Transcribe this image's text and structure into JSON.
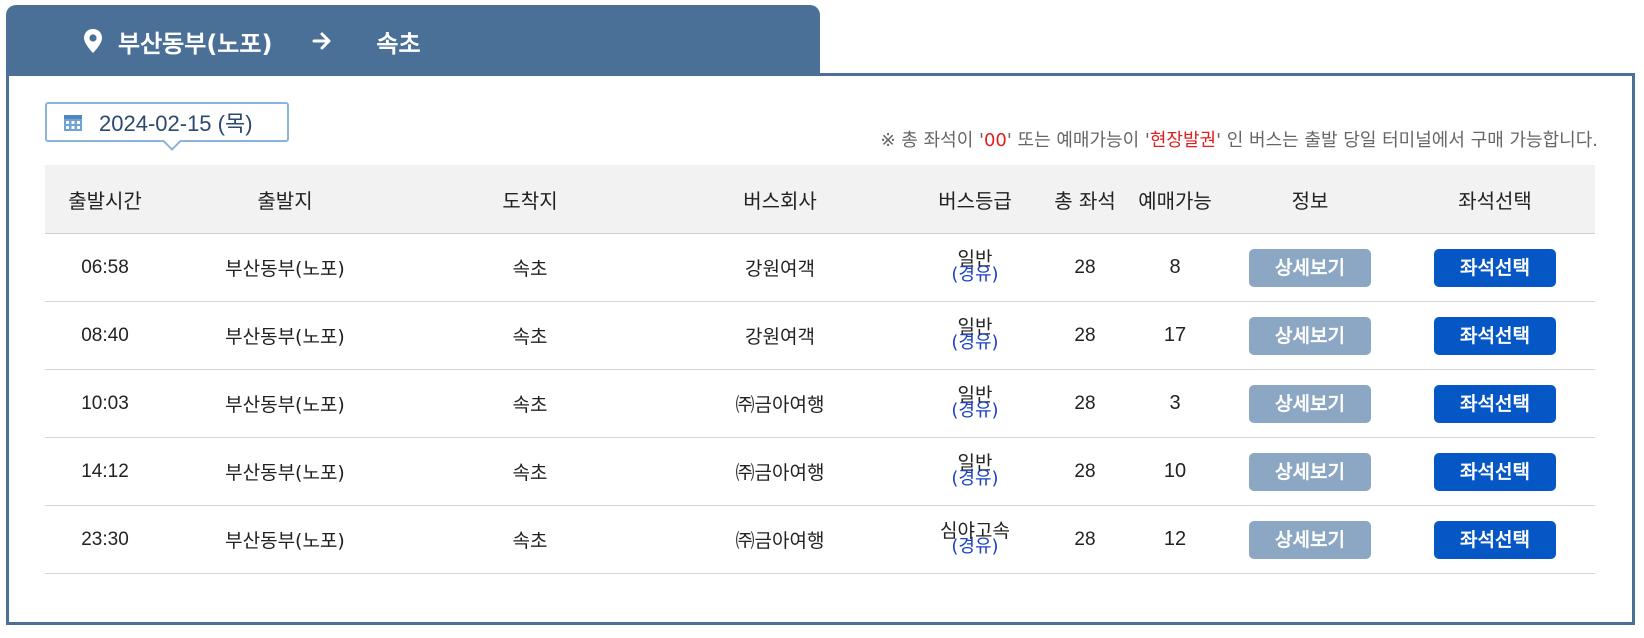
{
  "route": {
    "origin": "부산동부(노포)",
    "destination": "속초"
  },
  "date": {
    "label": "2024-02-15 (목)"
  },
  "notice": {
    "prefix": "※ 총 좌석이 '",
    "highlight1": "00",
    "middle": "' 또는 예매가능이 '",
    "highlight2": "현장발권",
    "suffix": "' 인 버스는 출발 당일 터미널에서 구매 가능합니다."
  },
  "table": {
    "headers": [
      "출발시간",
      "출발지",
      "도착지",
      "버스회사",
      "버스등급",
      "총 좌석",
      "예매가능",
      "정보",
      "좌석선택"
    ],
    "rows": [
      {
        "time": "06:58",
        "from": "부산동부(노포)",
        "to": "속초",
        "company": "강원여객",
        "grade": "일반",
        "route_type": "(경유)",
        "total": "28",
        "available": "8",
        "detail": "상세보기",
        "select": "좌석선택"
      },
      {
        "time": "08:40",
        "from": "부산동부(노포)",
        "to": "속초",
        "company": "강원여객",
        "grade": "일반",
        "route_type": "(경유)",
        "total": "28",
        "available": "17",
        "detail": "상세보기",
        "select": "좌석선택"
      },
      {
        "time": "10:03",
        "from": "부산동부(노포)",
        "to": "속초",
        "company": "㈜금아여행",
        "grade": "일반",
        "route_type": "(경유)",
        "total": "28",
        "available": "3",
        "detail": "상세보기",
        "select": "좌석선택"
      },
      {
        "time": "14:12",
        "from": "부산동부(노포)",
        "to": "속초",
        "company": "㈜금아여행",
        "grade": "일반",
        "route_type": "(경유)",
        "total": "28",
        "available": "10",
        "detail": "상세보기",
        "select": "좌석선택"
      },
      {
        "time": "23:30",
        "from": "부산동부(노포)",
        "to": "속초",
        "company": "㈜금아여행",
        "grade": "심야고속",
        "route_type": "(경유)",
        "total": "28",
        "available": "12",
        "detail": "상세보기",
        "select": "좌석선택"
      }
    ]
  },
  "icons": {
    "location": "map-pin-icon",
    "arrow": "arrow-right-icon",
    "calendar": "calendar-icon"
  },
  "colors": {
    "header_bg": "#4a7098",
    "detail_button": "#8ca7c4",
    "select_button": "#0657c6",
    "route_type": "#1b40c8",
    "notice_highlight": "#e02020"
  }
}
